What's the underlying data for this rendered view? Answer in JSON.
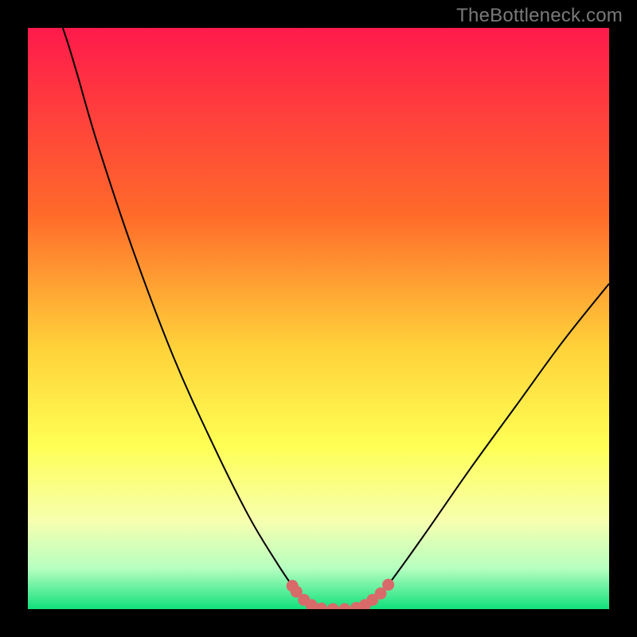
{
  "watermark": "TheBottleneck.com",
  "chart_data": {
    "type": "line",
    "title": "",
    "xlabel": "",
    "ylabel": "",
    "xlim": [
      0,
      100
    ],
    "ylim": [
      0,
      100
    ],
    "gradient_stops": [
      {
        "offset": 0,
        "color": "#ff1a4c"
      },
      {
        "offset": 32,
        "color": "#ff6a2a"
      },
      {
        "offset": 55,
        "color": "#ffd23a"
      },
      {
        "offset": 72,
        "color": "#ffff55"
      },
      {
        "offset": 85,
        "color": "#f6ffb0"
      },
      {
        "offset": 93,
        "color": "#b6ffc0"
      },
      {
        "offset": 100,
        "color": "#11e07c"
      }
    ],
    "series": [
      {
        "name": "curve",
        "color": "#000000",
        "points": [
          {
            "x": 6.0,
            "y": 100.0
          },
          {
            "x": 7.0,
            "y": 97.0
          },
          {
            "x": 8.5,
            "y": 92.0
          },
          {
            "x": 12.0,
            "y": 80.0
          },
          {
            "x": 18.0,
            "y": 62.0
          },
          {
            "x": 25.0,
            "y": 43.5
          },
          {
            "x": 32.0,
            "y": 28.0
          },
          {
            "x": 38.0,
            "y": 16.0
          },
          {
            "x": 42.5,
            "y": 8.5
          },
          {
            "x": 45.5,
            "y": 4.0
          },
          {
            "x": 47.5,
            "y": 1.6
          },
          {
            "x": 49.5,
            "y": 0.4
          },
          {
            "x": 52.0,
            "y": 0.0
          },
          {
            "x": 55.0,
            "y": 0.0
          },
          {
            "x": 57.5,
            "y": 0.4
          },
          {
            "x": 59.5,
            "y": 1.6
          },
          {
            "x": 62.0,
            "y": 4.2
          },
          {
            "x": 68.0,
            "y": 12.5
          },
          {
            "x": 76.0,
            "y": 24.0
          },
          {
            "x": 84.0,
            "y": 35.0
          },
          {
            "x": 92.0,
            "y": 46.0
          },
          {
            "x": 100.0,
            "y": 56.0
          }
        ]
      }
    ],
    "markers": {
      "color": "#d96a6a",
      "points": [
        {
          "x": 45.5,
          "y": 4.0
        },
        {
          "x": 46.2,
          "y": 3.0
        },
        {
          "x": 47.5,
          "y": 1.6
        },
        {
          "x": 48.8,
          "y": 0.7
        },
        {
          "x": 50.5,
          "y": 0.1
        },
        {
          "x": 52.5,
          "y": 0.0
        },
        {
          "x": 54.5,
          "y": 0.0
        },
        {
          "x": 56.5,
          "y": 0.2
        },
        {
          "x": 58.0,
          "y": 0.7
        },
        {
          "x": 59.3,
          "y": 1.6
        },
        {
          "x": 60.7,
          "y": 2.7
        },
        {
          "x": 62.0,
          "y": 4.2
        }
      ]
    }
  }
}
